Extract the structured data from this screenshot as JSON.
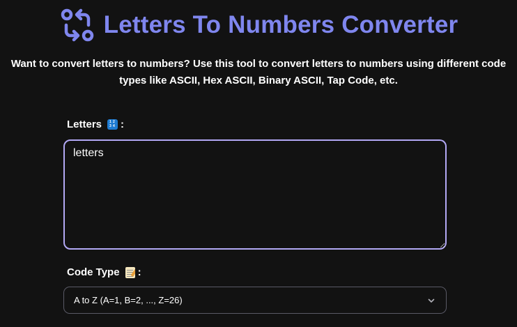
{
  "header": {
    "title": "Letters To Numbers Converter",
    "logo_icon": "arrows-swap-circles-icon",
    "accent_color": "#7f86ee"
  },
  "description": "Want to convert letters to numbers? Use this tool to convert letters to numbers using different code types like ASCII, Hex ASCII, Binary ASCII, Tap Code, etc.",
  "letters_field": {
    "label": "Letters",
    "label_suffix": ":",
    "emoji_icon": "input-numbers-icon",
    "value": "letters",
    "border_color": "#b2a8f4"
  },
  "code_type_field": {
    "label": "Code Type",
    "label_suffix": ":",
    "emoji_icon": "memo-icon",
    "selected": "A to Z (A=1, B=2, ..., Z=26)"
  }
}
